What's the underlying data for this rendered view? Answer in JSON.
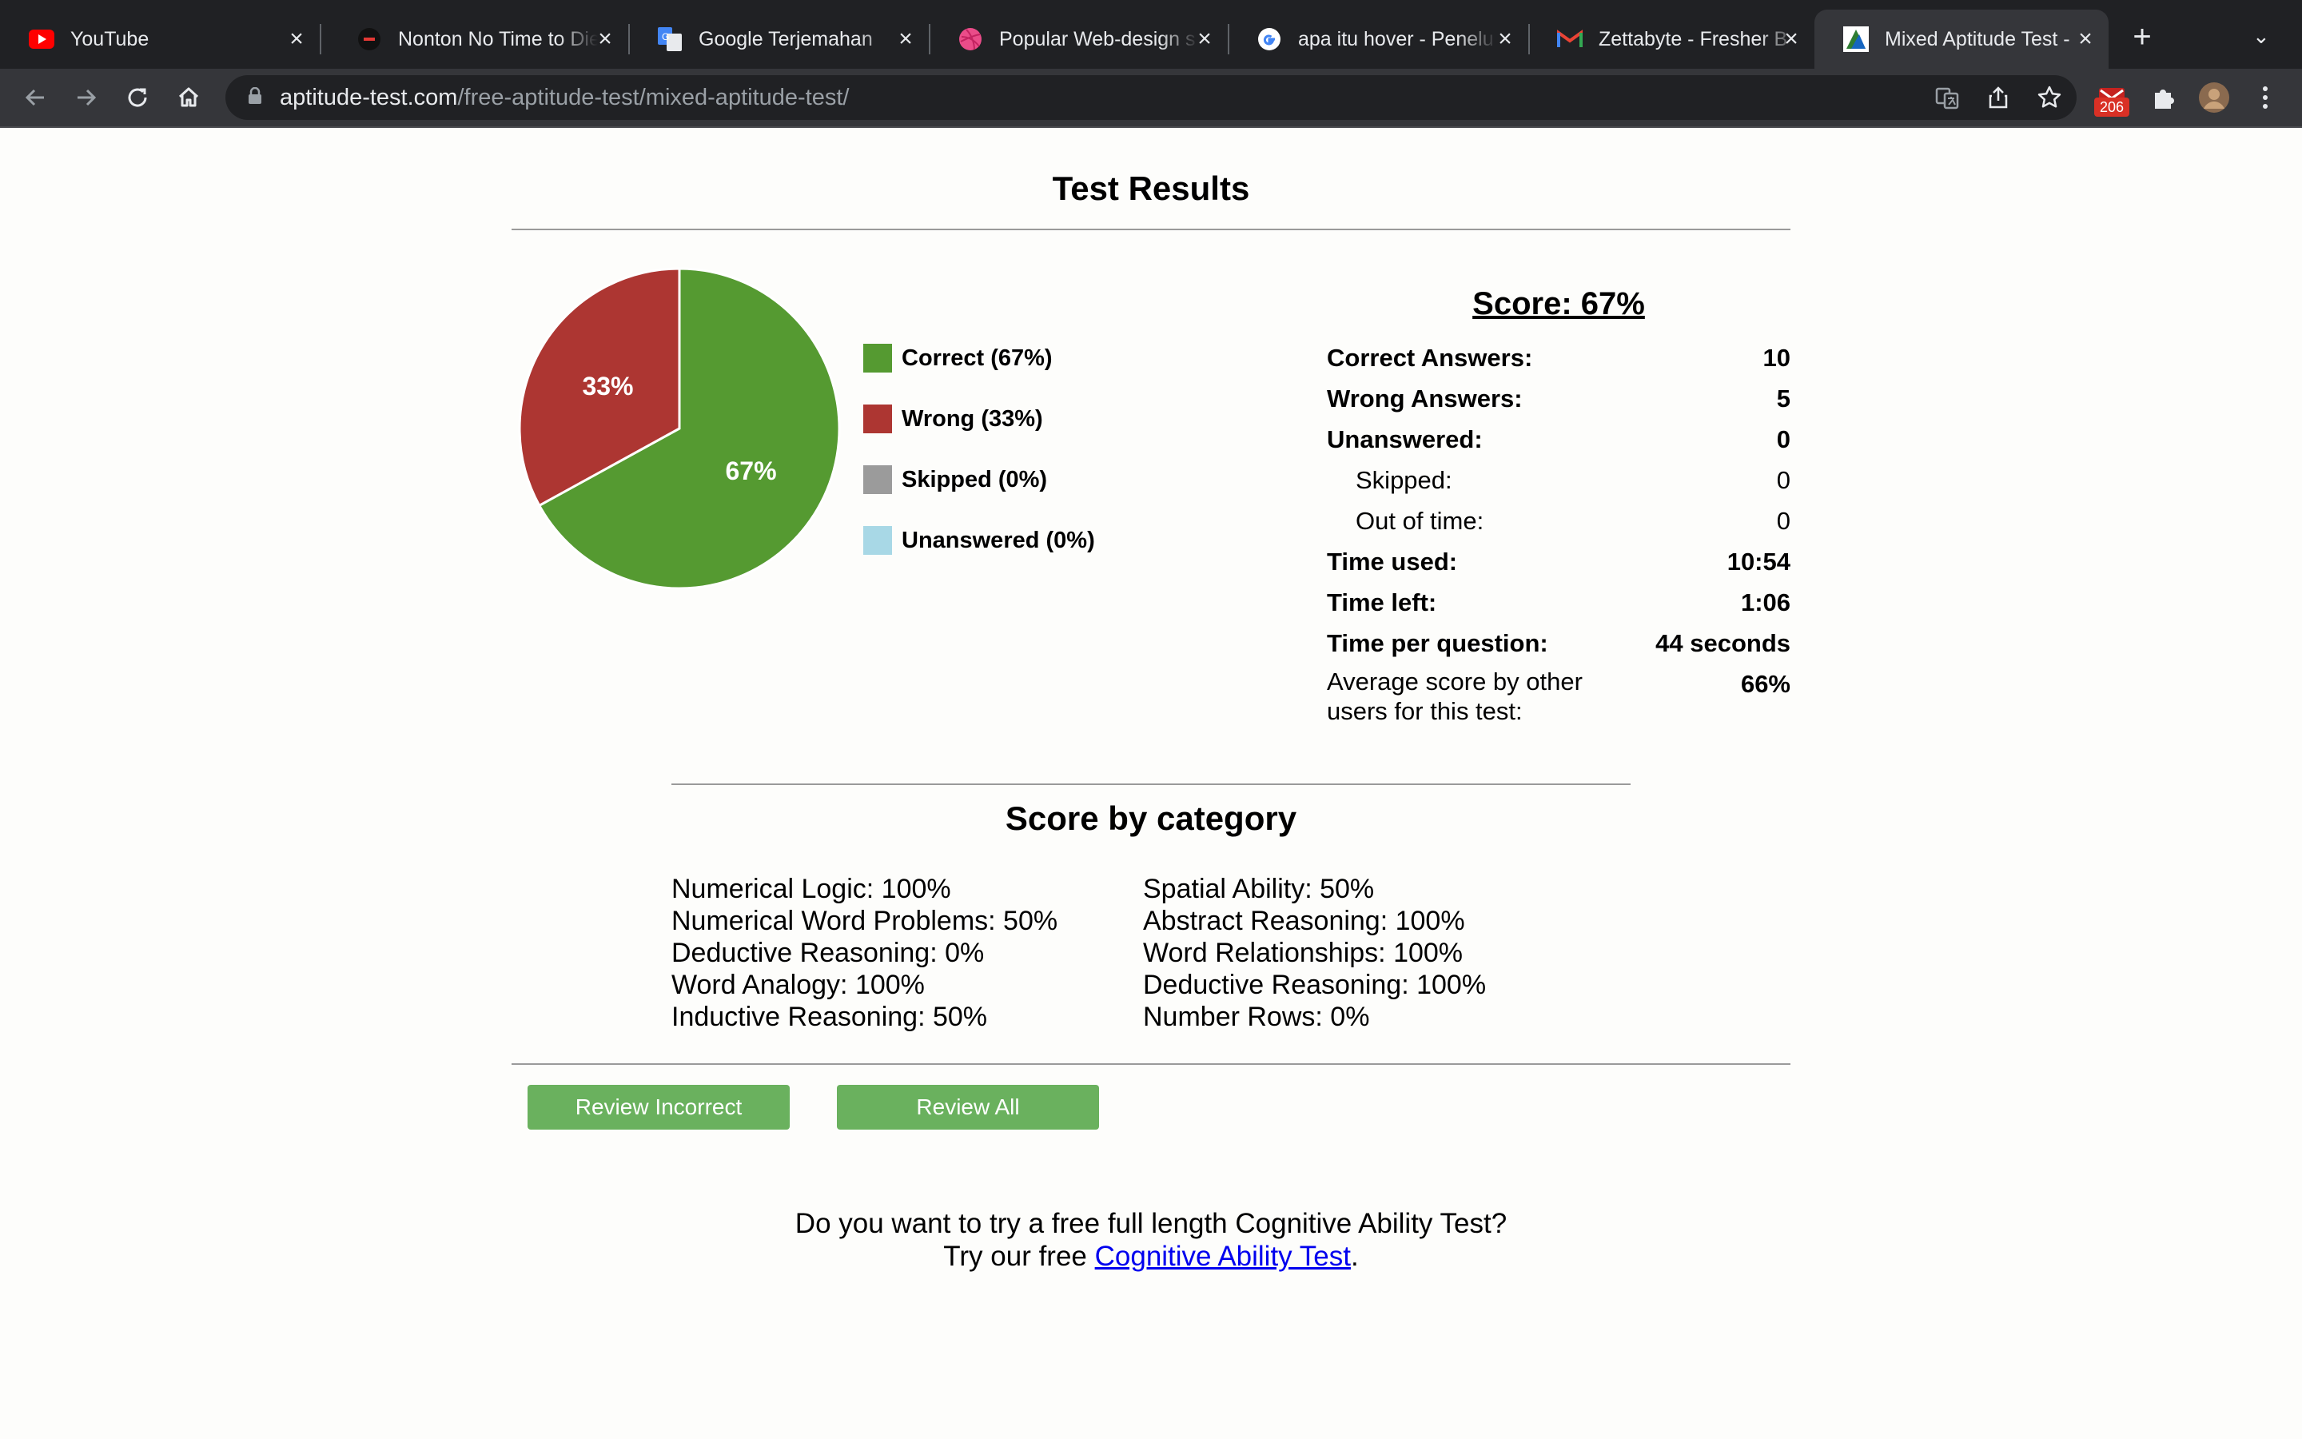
{
  "browser": {
    "tabs": [
      {
        "title": "YouTube",
        "icon": "youtube-icon",
        "active": false
      },
      {
        "title": "Nonton No Time to Die",
        "icon": "movie-site-icon",
        "active": false
      },
      {
        "title": "Google Terjemahan",
        "icon": "google-translate-icon",
        "active": false
      },
      {
        "title": "Popular Web-design s",
        "icon": "dribbble-icon",
        "active": false
      },
      {
        "title": "apa itu hover - Penelu",
        "icon": "google-icon",
        "active": false
      },
      {
        "title": "Zettabyte - Fresher B",
        "icon": "gmail-icon",
        "active": false
      },
      {
        "title": "Mixed Aptitude Test -",
        "icon": "aptitude-test-icon",
        "active": true
      }
    ],
    "url_host": "aptitude-test.com",
    "url_path": "/free-aptitude-test/mixed-aptitude-test/",
    "extension_badge": "206"
  },
  "results": {
    "title": "Test Results",
    "score_title": "Score: 67%",
    "stats": [
      {
        "label": "Correct Answers:",
        "value": "10",
        "bold": true,
        "sub": false
      },
      {
        "label": "Wrong Answers:",
        "value": "5",
        "bold": true,
        "sub": false
      },
      {
        "label": "Unanswered:",
        "value": "0",
        "bold": true,
        "sub": false
      },
      {
        "label": "Skipped:",
        "value": "0",
        "bold": false,
        "sub": true
      },
      {
        "label": "Out of time:",
        "value": "0",
        "bold": false,
        "sub": true
      },
      {
        "label": "Time used:",
        "value": "10:54",
        "bold": true,
        "sub": false
      },
      {
        "label": "Time left:",
        "value": "1:06",
        "bold": true,
        "sub": false
      },
      {
        "label": "Time per question:",
        "value": "44 seconds",
        "bold": true,
        "sub": false
      },
      {
        "label_line1": "Average score by other",
        "label_line2": "users for this test:",
        "value": "66%",
        "bold": false,
        "sub": false
      }
    ]
  },
  "chart_data": {
    "type": "pie",
    "slices": [
      {
        "name": "Correct",
        "value": 67,
        "label": "67%",
        "color": "#559a31"
      },
      {
        "name": "Wrong",
        "value": 33,
        "label": "33%",
        "color": "#ad3632"
      },
      {
        "name": "Skipped",
        "value": 0,
        "label": "",
        "color": "#9b9b9b"
      },
      {
        "name": "Unanswered",
        "value": 0,
        "label": "",
        "color": "#a8d8e6"
      }
    ],
    "legend": [
      {
        "text": "Correct (67%)",
        "color": "#559a31"
      },
      {
        "text": "Wrong (33%)",
        "color": "#ad3632"
      },
      {
        "text": "Skipped (0%)",
        "color": "#9b9b9b"
      },
      {
        "text": "Unanswered (0%)",
        "color": "#a8d8e6"
      }
    ],
    "legend_placement": "right"
  },
  "categories": {
    "title": "Score by category",
    "left": [
      "Numerical Logic: 100%",
      "Numerical Word Problems: 50%",
      "Deductive Reasoning: 0%",
      "Word Analogy: 100%",
      "Inductive Reasoning: 50%"
    ],
    "right": [
      "Spatial Ability: 50%",
      "Abstract Reasoning: 100%",
      "Word Relationships: 100%",
      "Deductive Reasoning: 100%",
      "Number Rows: 0%"
    ]
  },
  "buttons": {
    "review_incorrect": "Review Incorrect",
    "review_all": "Review All"
  },
  "promo": {
    "line1": "Do you want to try a free full length Cognitive Ability Test?",
    "line2_prefix": "Try our free ",
    "link_text": "Cognitive Ability Test",
    "line2_suffix": "."
  }
}
